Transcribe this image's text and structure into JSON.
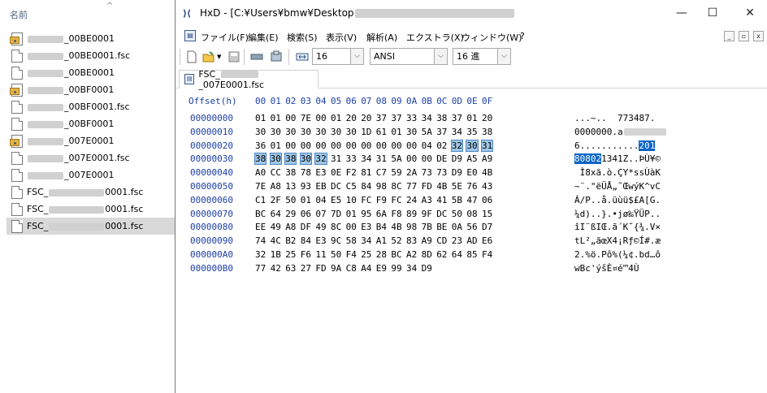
{
  "explorer": {
    "column_header": "名前",
    "files": [
      {
        "prefix": "",
        "suffix": "_00BE0001",
        "icon": "sys-file-icon",
        "blur": 44
      },
      {
        "prefix": "",
        "suffix": "_00BE0001.fsc",
        "icon": "doc-file-icon",
        "blur": 44
      },
      {
        "prefix": "",
        "suffix": "_00BE0001",
        "icon": "doc-file-icon",
        "blur": 44
      },
      {
        "prefix": "",
        "suffix": "_00BF0001",
        "icon": "sys-file-icon",
        "blur": 44
      },
      {
        "prefix": "",
        "suffix": "_00BF0001.fsc",
        "icon": "doc-file-icon",
        "blur": 44
      },
      {
        "prefix": "",
        "suffix": "_00BF0001",
        "icon": "doc-file-icon",
        "blur": 44
      },
      {
        "prefix": "",
        "suffix": "_007E0001",
        "icon": "sys-file-icon",
        "blur": 44
      },
      {
        "prefix": "",
        "suffix": "_007E0001.fsc",
        "icon": "doc-file-icon",
        "blur": 44
      },
      {
        "prefix": "",
        "suffix": "_007E0001",
        "icon": "doc-file-icon",
        "blur": 44
      },
      {
        "prefix": "FSC_",
        "suffix": "0001.fsc",
        "icon": "doc-file-icon",
        "blur": 68
      },
      {
        "prefix": "FSC_",
        "suffix": "0001.fsc",
        "icon": "doc-file-icon",
        "blur": 68
      },
      {
        "prefix": "FSC_",
        "suffix": "0001.fsc",
        "icon": "doc-file-icon",
        "blur": 68,
        "selected": true
      }
    ]
  },
  "hxd": {
    "app_icon": "HxD",
    "title": "HxD - [C:¥Users¥bmw¥Desktop",
    "menu": [
      "ファイル(F)",
      "編集(E)",
      "検索(S)",
      "表示(V)",
      "解析(A)",
      "エクストラ(X)",
      "ウィンドウ(W)",
      "?"
    ],
    "toolbar": {
      "bytes_per_row": "16",
      "charset": "ANSI",
      "offset_base": "16 進"
    },
    "tab_label": "FSC_",
    "tab_label_suffix": "_007E0001.fsc",
    "header_offset": "Offset(h)",
    "header_columns": [
      "00",
      "01",
      "02",
      "03",
      "04",
      "05",
      "06",
      "07",
      "08",
      "09",
      "0A",
      "0B",
      "0C",
      "0D",
      "0E",
      "0F"
    ],
    "rows": [
      {
        "offset": "00000000",
        "bytes": [
          "01",
          "01",
          "00",
          "7E",
          "00",
          "01",
          "20",
          "20",
          "37",
          "37",
          "33",
          "34",
          "38",
          "37",
          "01",
          "20"
        ],
        "ascii": "...~..  773487. "
      },
      {
        "offset": "00000010",
        "bytes": [
          "30",
          "30",
          "30",
          "30",
          "30",
          "30",
          "30",
          "1D",
          "61",
          "01",
          "30",
          "5A",
          "37",
          "34",
          "35",
          "38"
        ],
        "ascii": "0000000.a"
      },
      {
        "offset": "00000020",
        "bytes": [
          "36",
          "01",
          "00",
          "00",
          "00",
          "00",
          "00",
          "00",
          "00",
          "00",
          "00",
          "04",
          "02",
          "32",
          "30",
          "31"
        ],
        "ascii": "6...........",
        "ascii_sel": "201"
      },
      {
        "offset": "00000030",
        "bytes": [
          "38",
          "30",
          "38",
          "30",
          "32",
          "31",
          "33",
          "34",
          "31",
          "5A",
          "00",
          "00",
          "DE",
          "D9",
          "A5",
          "A9"
        ],
        "ascii_sel_pre": "80802",
        "ascii": "1341Z..ÞÙ¥©"
      },
      {
        "offset": "00000040",
        "bytes": [
          "A0",
          "CC",
          "38",
          "78",
          "E3",
          "0E",
          "F2",
          "81",
          "C7",
          "59",
          "2A",
          "73",
          "73",
          "D9",
          "E0",
          "4B"
        ],
        "ascii": " Ì8xã.ò.ÇY*ssÙàK"
      },
      {
        "offset": "00000050",
        "bytes": [
          "7E",
          "A8",
          "13",
          "93",
          "EB",
          "DC",
          "C5",
          "84",
          "98",
          "8C",
          "77",
          "FD",
          "4B",
          "5E",
          "76",
          "43"
        ],
        "ascii": "~¨.\"ëÜÅ„˜ŒwýK^vC"
      },
      {
        "offset": "00000060",
        "bytes": [
          "C1",
          "2F",
          "50",
          "01",
          "04",
          "E5",
          "10",
          "FC",
          "F9",
          "FC",
          "24",
          "A3",
          "41",
          "5B",
          "47",
          "06"
        ],
        "ascii": "Á/P..å.üùü$£A[G."
      },
      {
        "offset": "00000070",
        "bytes": [
          "BC",
          "64",
          "29",
          "06",
          "07",
          "7D",
          "01",
          "95",
          "6A",
          "F8",
          "89",
          "9F",
          "DC",
          "50",
          "08",
          "15"
        ],
        "ascii": "¼d)..}.•jø‰ŸÜP.."
      },
      {
        "offset": "00000080",
        "bytes": [
          "EE",
          "49",
          "A8",
          "DF",
          "49",
          "8C",
          "00",
          "E3",
          "B4",
          "4B",
          "98",
          "7B",
          "BE",
          "0A",
          "56",
          "D7"
        ],
        "ascii": "îI¨ßIŒ.ã´K˜{¾.V×"
      },
      {
        "offset": "00000090",
        "bytes": [
          "74",
          "4C",
          "B2",
          "84",
          "E3",
          "9C",
          "58",
          "34",
          "A1",
          "52",
          "83",
          "A9",
          "CD",
          "23",
          "AD",
          "E6"
        ],
        "ascii": "tL²„ãœX4¡Rƒ©Í#.æ"
      },
      {
        "offset": "000000A0",
        "bytes": [
          "32",
          "1B",
          "25",
          "F6",
          "11",
          "50",
          "F4",
          "25",
          "28",
          "BC",
          "A2",
          "8D",
          "62",
          "64",
          "85",
          "F4"
        ],
        "ascii": "2.%ö.Pô%(¼¢.bd…ô"
      },
      {
        "offset": "000000B0",
        "bytes": [
          "77",
          "42",
          "63",
          "27",
          "FD",
          "9A",
          "C8",
          "A4",
          "E9",
          "99",
          "34",
          "D9"
        ],
        "ascii": "wBc'ýšÈ¤é™4Ù"
      }
    ],
    "selected_bytes": "0x2D-0x34"
  }
}
